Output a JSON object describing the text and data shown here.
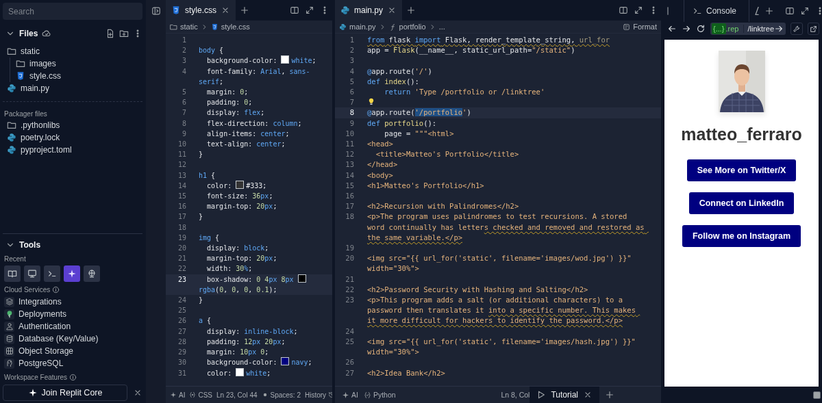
{
  "sidebar": {
    "search": {
      "placeholder": "Search"
    },
    "files": {
      "title": "Files",
      "expanded": true,
      "tree": [
        {
          "name": "static",
          "kind": "folder",
          "expanded": true,
          "children": [
            {
              "name": "images",
              "kind": "folder"
            },
            {
              "name": "style.css",
              "kind": "css"
            }
          ]
        },
        {
          "name": "main.py",
          "kind": "python"
        }
      ]
    },
    "packager": {
      "title": "Packager files",
      "items": [
        {
          "name": ".pythonlibs",
          "kind": "folder"
        },
        {
          "name": "poetry.lock",
          "kind": "python"
        },
        {
          "name": "pyproject.toml",
          "kind": "python"
        }
      ]
    },
    "tools": {
      "title": "Tools",
      "expanded": true,
      "recent_label": "Recent",
      "recent": [
        {
          "kind": "book",
          "selected": false
        },
        {
          "kind": "monitor",
          "selected": false
        },
        {
          "kind": "terminal",
          "selected": false
        },
        {
          "kind": "sparkle",
          "selected": true
        },
        {
          "kind": "orb",
          "selected": false
        }
      ],
      "cloud_label": "Cloud Services",
      "services": [
        {
          "label": "Integrations",
          "kind": "layers"
        },
        {
          "label": "Deployments",
          "kind": "tree"
        },
        {
          "label": "Authentication",
          "kind": "person"
        },
        {
          "label": "Database (Key/Value)",
          "kind": "database"
        },
        {
          "label": "Object Storage",
          "kind": "grid"
        },
        {
          "label": "PostgreSQL",
          "kind": "elephant"
        }
      ],
      "workspace_label": "Workspace Features",
      "cta": "Join Replit Core"
    }
  },
  "css_editor": {
    "tab": {
      "label": "style.css",
      "kind": "css"
    },
    "breadcrumb": [
      {
        "label": "static",
        "kind": "folder"
      },
      {
        "label": "style.css",
        "kind": "css"
      }
    ],
    "lines": [
      {
        "number": "1",
        "current": false
      },
      {
        "number": "2",
        "current": false,
        "tokens": [
          {
            "kind": "tag",
            "text": "body"
          },
          {
            "kind": "p",
            "text": " {"
          }
        ]
      },
      {
        "number": "3",
        "current": false,
        "tokens": [
          {
            "kind": "p",
            "text": "  background-color: "
          },
          {
            "kind": "swatch",
            "color": "#ffffff"
          },
          {
            "kind": "v",
            "text": "white"
          },
          {
            "kind": "p",
            "text": ";"
          }
        ]
      },
      {
        "number": "4",
        "current": false,
        "tokens": [
          {
            "kind": "p",
            "text": "  font-family: "
          },
          {
            "kind": "v",
            "text": "Arial"
          },
          {
            "kind": "p",
            "text": ", "
          },
          {
            "kind": "v",
            "text": "sans-serif"
          },
          {
            "kind": "p",
            "text": ";"
          }
        ]
      },
      {
        "number": "5",
        "current": false,
        "tokens": [
          {
            "kind": "p",
            "text": "  margin: "
          },
          {
            "kind": "n",
            "text": "0"
          },
          {
            "kind": "p",
            "text": ";"
          }
        ]
      },
      {
        "number": "6",
        "current": false,
        "tokens": [
          {
            "kind": "p",
            "text": "  padding: "
          },
          {
            "kind": "n",
            "text": "0"
          },
          {
            "kind": "p",
            "text": ";"
          }
        ]
      },
      {
        "number": "7",
        "current": false,
        "tokens": [
          {
            "kind": "p",
            "text": "  display: "
          },
          {
            "kind": "v",
            "text": "flex"
          },
          {
            "kind": "p",
            "text": ";"
          }
        ]
      },
      {
        "number": "8",
        "current": false,
        "tokens": [
          {
            "kind": "p",
            "text": "  flex-direction: "
          },
          {
            "kind": "v",
            "text": "column"
          },
          {
            "kind": "p",
            "text": ";"
          }
        ]
      },
      {
        "number": "9",
        "current": false,
        "tokens": [
          {
            "kind": "p",
            "text": "  align-items: "
          },
          {
            "kind": "v",
            "text": "center"
          },
          {
            "kind": "p",
            "text": ";"
          }
        ]
      },
      {
        "number": "10",
        "current": false,
        "tokens": [
          {
            "kind": "p",
            "text": "  text-align: "
          },
          {
            "kind": "v",
            "text": "center"
          },
          {
            "kind": "p",
            "text": ";"
          }
        ]
      },
      {
        "number": "11",
        "current": false,
        "tokens": [
          {
            "kind": "p",
            "text": "}"
          }
        ]
      },
      {
        "number": "12",
        "current": false
      },
      {
        "number": "13",
        "current": false,
        "tokens": [
          {
            "kind": "tag",
            "text": "h1"
          },
          {
            "kind": "p",
            "text": " {"
          }
        ]
      },
      {
        "number": "14",
        "current": false,
        "tokens": [
          {
            "kind": "p",
            "text": "  color: "
          },
          {
            "kind": "swatch",
            "color": "#333333"
          },
          {
            "kind": "p",
            "text": "#333;"
          }
        ]
      },
      {
        "number": "15",
        "current": false,
        "tokens": [
          {
            "kind": "p",
            "text": "  font-size: "
          },
          {
            "kind": "n",
            "text": "36"
          },
          {
            "kind": "v",
            "text": "px"
          },
          {
            "kind": "p",
            "text": ";"
          }
        ]
      },
      {
        "number": "16",
        "current": false,
        "tokens": [
          {
            "kind": "p",
            "text": "  margin-top: "
          },
          {
            "kind": "n",
            "text": "20"
          },
          {
            "kind": "v",
            "text": "px"
          },
          {
            "kind": "p",
            "text": ";"
          }
        ]
      },
      {
        "number": "17",
        "current": false,
        "tokens": [
          {
            "kind": "p",
            "text": "}"
          }
        ]
      },
      {
        "number": "18",
        "current": false
      },
      {
        "number": "19",
        "current": false,
        "tokens": [
          {
            "kind": "tag",
            "text": "img"
          },
          {
            "kind": "p",
            "text": " {"
          }
        ]
      },
      {
        "number": "20",
        "current": false,
        "tokens": [
          {
            "kind": "p",
            "text": "  display: "
          },
          {
            "kind": "v",
            "text": "block"
          },
          {
            "kind": "p",
            "text": ";"
          }
        ]
      },
      {
        "number": "21",
        "current": false,
        "tokens": [
          {
            "kind": "p",
            "text": "  margin-top: "
          },
          {
            "kind": "n",
            "text": "20"
          },
          {
            "kind": "v",
            "text": "px"
          },
          {
            "kind": "p",
            "text": ";"
          }
        ]
      },
      {
        "number": "22",
        "current": false,
        "tokens": [
          {
            "kind": "p",
            "text": "  width: "
          },
          {
            "kind": "n",
            "text": "30"
          },
          {
            "kind": "v",
            "text": "%"
          },
          {
            "kind": "p",
            "text": ";"
          }
        ]
      },
      {
        "number": "23",
        "current": true,
        "tokens": [
          {
            "kind": "p",
            "text": "  box-shadow: "
          },
          {
            "kind": "n",
            "text": "0 "
          },
          {
            "kind": "n",
            "text": "4"
          },
          {
            "kind": "v",
            "text": "px "
          },
          {
            "kind": "n",
            "text": "8"
          },
          {
            "kind": "v",
            "text": "px "
          },
          {
            "kind": "swatch",
            "color": "#000000"
          },
          {
            "kind": "v",
            "text": "rgba"
          },
          {
            "kind": "p",
            "text": "("
          },
          {
            "kind": "n",
            "text": "0"
          },
          {
            "kind": "p",
            "text": ", "
          },
          {
            "kind": "n",
            "text": "0"
          },
          {
            "kind": "p",
            "text": ", "
          },
          {
            "kind": "n",
            "text": "0"
          },
          {
            "kind": "p",
            "text": ", "
          },
          {
            "kind": "n",
            "text": "0.1"
          },
          {
            "kind": "p",
            "text": ");"
          }
        ]
      },
      {
        "number": "24",
        "current": false,
        "tokens": [
          {
            "kind": "p",
            "text": "}"
          }
        ]
      },
      {
        "number": "25",
        "current": false
      },
      {
        "number": "26",
        "current": false,
        "tokens": [
          {
            "kind": "tag",
            "text": "a"
          },
          {
            "kind": "p",
            "text": " {"
          }
        ]
      },
      {
        "number": "27",
        "current": false,
        "tokens": [
          {
            "kind": "p",
            "text": "  display: "
          },
          {
            "kind": "v",
            "text": "inline-block"
          },
          {
            "kind": "p",
            "text": ";"
          }
        ]
      },
      {
        "number": "28",
        "current": false,
        "tokens": [
          {
            "kind": "p",
            "text": "  padding: "
          },
          {
            "kind": "n",
            "text": "12"
          },
          {
            "kind": "v",
            "text": "px "
          },
          {
            "kind": "n",
            "text": "20"
          },
          {
            "kind": "v",
            "text": "px"
          },
          {
            "kind": "p",
            "text": ";"
          }
        ]
      },
      {
        "number": "29",
        "current": false,
        "tokens": [
          {
            "kind": "p",
            "text": "  margin: "
          },
          {
            "kind": "n",
            "text": "10"
          },
          {
            "kind": "v",
            "text": "px "
          },
          {
            "kind": "n",
            "text": "0"
          },
          {
            "kind": "p",
            "text": ";"
          }
        ]
      },
      {
        "number": "30",
        "current": false,
        "tokens": [
          {
            "kind": "p",
            "text": "  background-color: "
          },
          {
            "kind": "swatch",
            "color": "#000080"
          },
          {
            "kind": "v",
            "text": "navy"
          },
          {
            "kind": "p",
            "text": ";"
          }
        ]
      },
      {
        "number": "31",
        "current": false,
        "tokens": [
          {
            "kind": "p",
            "text": "  color: "
          },
          {
            "kind": "swatch",
            "color": "#ffffff"
          },
          {
            "kind": "v",
            "text": "white"
          },
          {
            "kind": "p",
            "text": ";"
          }
        ]
      }
    ],
    "status": [
      {
        "kind": "ai",
        "text": "AI"
      },
      {
        "kind": "lang",
        "text": "CSS"
      },
      {
        "kind": "pos",
        "text": "Ln 23, Col 44"
      },
      {
        "kind": "spaces",
        "text": "Spaces: 2"
      },
      {
        "kind": "history",
        "text": "History"
      }
    ]
  },
  "python_editor": {
    "tab": {
      "label": "main.py",
      "kind": "python"
    },
    "breadcrumb": [
      {
        "label": "main.py",
        "kind": "python"
      },
      {
        "label": "portfolio",
        "kind": "function"
      },
      {
        "label": "...",
        "kind": "plain"
      }
    ],
    "format": "Format",
    "lines": [
      {
        "number": "1",
        "current": false,
        "tokens": [
          {
            "kind": "kw-warn",
            "text": "from"
          },
          {
            "kind": "p-warn",
            "text": " flask "
          },
          {
            "kind": "kw-warn",
            "text": "import"
          },
          {
            "kind": "p-warn",
            "text": " Flask, render_template_string, "
          },
          {
            "kind": "dim-warn",
            "text": "url_for"
          }
        ]
      },
      {
        "number": "2",
        "current": false,
        "tokens": [
          {
            "kind": "p",
            "text": "app = "
          },
          {
            "kind": "fn",
            "text": "Flask"
          },
          {
            "kind": "p",
            "text": "(__name__, static_url_path="
          },
          {
            "kind": "str",
            "text": "\"/static\""
          },
          {
            "kind": "p",
            "text": ")"
          }
        ]
      },
      {
        "number": "3",
        "current": false
      },
      {
        "number": "4",
        "current": false,
        "tokens": [
          {
            "kind": "kw",
            "text": "@"
          },
          {
            "kind": "p",
            "text": "app.route("
          },
          {
            "kind": "str",
            "text": "'/'"
          },
          {
            "kind": "p",
            "text": ")"
          }
        ]
      },
      {
        "number": "5",
        "current": false,
        "tokens": [
          {
            "kind": "kw",
            "text": "def "
          },
          {
            "kind": "fn",
            "text": "index"
          },
          {
            "kind": "p",
            "text": "():"
          }
        ]
      },
      {
        "number": "6",
        "current": false,
        "tokens": [
          {
            "kind": "kw",
            "text": "    return "
          },
          {
            "kind": "str",
            "text": "'Type /portfolio or /linktree'"
          }
        ]
      },
      {
        "number": "7",
        "current": false,
        "tokens": [
          {
            "kind": "bulb"
          }
        ]
      },
      {
        "number": "8",
        "current": true,
        "tokens": [
          {
            "kind": "kw",
            "text": "@"
          },
          {
            "kind": "p",
            "text": "app.route("
          },
          {
            "kind": "str-hl",
            "text": "'/portfolio"
          },
          {
            "kind": "str",
            "text": "'"
          },
          {
            "kind": "p",
            "text": ")"
          }
        ]
      },
      {
        "number": "9",
        "current": false,
        "tokens": [
          {
            "kind": "kw",
            "text": "def "
          },
          {
            "kind": "fn",
            "text": "portfolio"
          },
          {
            "kind": "p",
            "text": "():"
          }
        ]
      },
      {
        "number": "10",
        "current": false,
        "tokens": [
          {
            "kind": "p",
            "text": "    page = "
          },
          {
            "kind": "str",
            "text": "\"\"\"<html>"
          }
        ]
      },
      {
        "number": "11",
        "current": false,
        "tokens": [
          {
            "kind": "str",
            "text": "<head>"
          }
        ]
      },
      {
        "number": "12",
        "current": false,
        "tokens": [
          {
            "kind": "str",
            "text": "  <title>Matteo's Portfolio</title>"
          }
        ]
      },
      {
        "number": "13",
        "current": false,
        "tokens": [
          {
            "kind": "str",
            "text": "</head>"
          }
        ]
      },
      {
        "number": "14",
        "current": false,
        "tokens": [
          {
            "kind": "str",
            "text": "<body>"
          }
        ]
      },
      {
        "number": "15",
        "current": false,
        "tokens": [
          {
            "kind": "str",
            "text": "<h1>Matteo's Portfolio</h1>"
          }
        ]
      },
      {
        "number": "16",
        "current": false
      },
      {
        "number": "17",
        "current": false,
        "tokens": [
          {
            "kind": "str",
            "text": "<h2>Recursion with Palindromes</h2>"
          }
        ]
      },
      {
        "number": "18",
        "current": false,
        "tokens": [
          {
            "kind": "str",
            "text": "<p>The program uses palindromes to test recursions. A stored word continually has letter"
          },
          {
            "kind": "str-warn",
            "text": "s checked and removed and restored as the same variable.</p>"
          }
        ]
      },
      {
        "number": "19",
        "current": false
      },
      {
        "number": "20",
        "current": false,
        "tokens": [
          {
            "kind": "str",
            "text": "<img src=\"{{ url_for('static', filename='images/wod.jpg') }}\" width=\"30%\">"
          }
        ]
      },
      {
        "number": "21",
        "current": false
      },
      {
        "number": "22",
        "current": false,
        "tokens": [
          {
            "kind": "str",
            "text": "<h2>Password Security with Hashing and Salting</h2>"
          }
        ]
      },
      {
        "number": "23",
        "current": false,
        "tokens": [
          {
            "kind": "str",
            "text": "<p>This program adds a salt (or additional characters) to a password then translates it "
          },
          {
            "kind": "str-warn",
            "text": "into a specific number. This makes it more difficult for hackers to identify the password.</p>"
          }
        ]
      },
      {
        "number": "24",
        "current": false
      },
      {
        "number": "25",
        "current": false,
        "tokens": [
          {
            "kind": "str",
            "text": "<img src=\"{{ url_for('static', filename='images/hash.jpg') }}\" width=\"30%\">"
          }
        ]
      },
      {
        "number": "26",
        "current": false
      },
      {
        "number": "27",
        "current": false,
        "tokens": [
          {
            "kind": "str",
            "text": "<h2>Idea Bank</h2>"
          }
        ]
      }
    ],
    "status": [
      {
        "kind": "ai",
        "text": "AI"
      },
      {
        "kind": "lang-ok",
        "text": "Python"
      },
      {
        "kind": "pos",
        "text": "Ln 8, Col"
      }
    ],
    "bottom_tabs": [
      {
        "label": "Tutorial"
      }
    ]
  },
  "preview": {
    "tabs": [
      {
        "label": "Console"
      }
    ],
    "url": {
      "badge": "{...}",
      "host": ".rep",
      "path": "/linktree"
    },
    "page": {
      "name": "matteo_ferraro",
      "links": [
        "See More on Twitter/X",
        "Connect on LinkedIn",
        "Follow me on Instagram"
      ]
    }
  }
}
